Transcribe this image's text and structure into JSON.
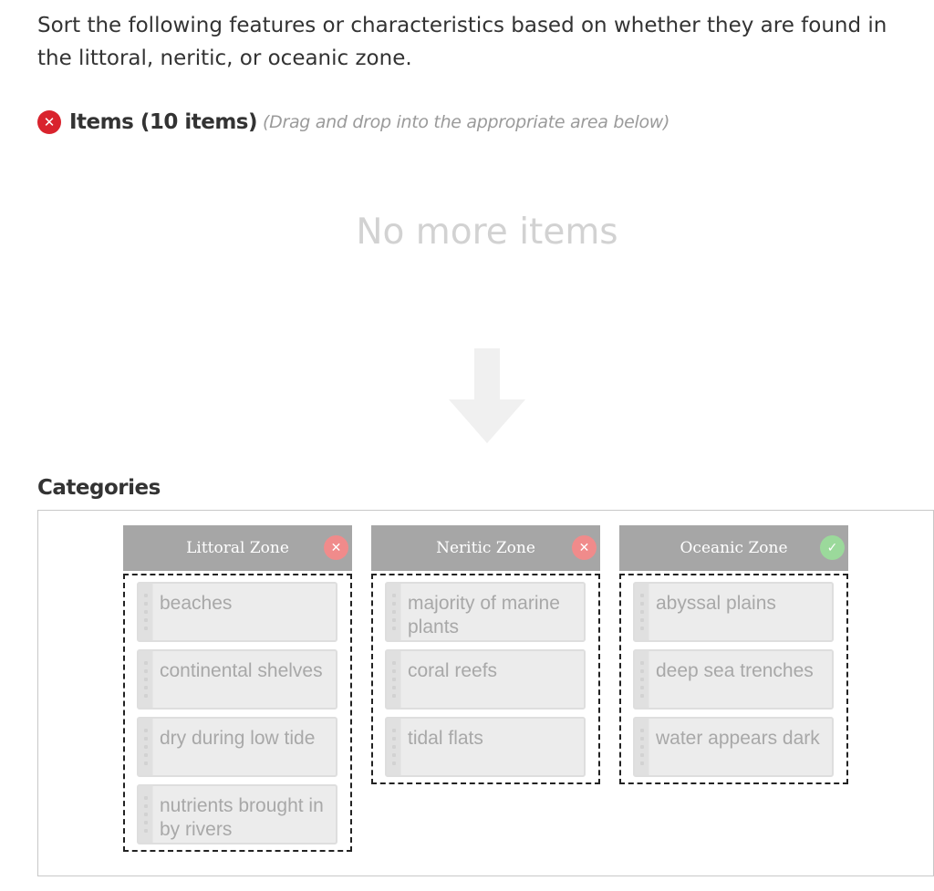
{
  "question": "Sort the following features or characteristics based on whether they are found in the littoral, neritic, or oceanic zone.",
  "items_header": {
    "title": "Items (10 items)",
    "hint": "(Drag and drop into the appropriate area below)"
  },
  "empty_state": "No more items",
  "categories_label": "Categories",
  "categories": [
    {
      "title": "Littoral Zone",
      "status": "incorrect",
      "items": [
        "beaches",
        "continental shelves",
        "dry during low tide",
        "nutrients brought in by rivers"
      ]
    },
    {
      "title": "Neritic Zone",
      "status": "incorrect",
      "items": [
        "majority of marine plants",
        "coral reefs",
        "tidal flats"
      ]
    },
    {
      "title": "Oceanic Zone",
      "status": "correct",
      "items": [
        "abyssal plains",
        "deep sea trenches",
        "water appears dark"
      ]
    }
  ],
  "colors": {
    "error": "#d9232d",
    "incorrect_badge": "#f08b8b",
    "correct_badge": "#9bd99b",
    "category_header": "#a6a6a6"
  }
}
